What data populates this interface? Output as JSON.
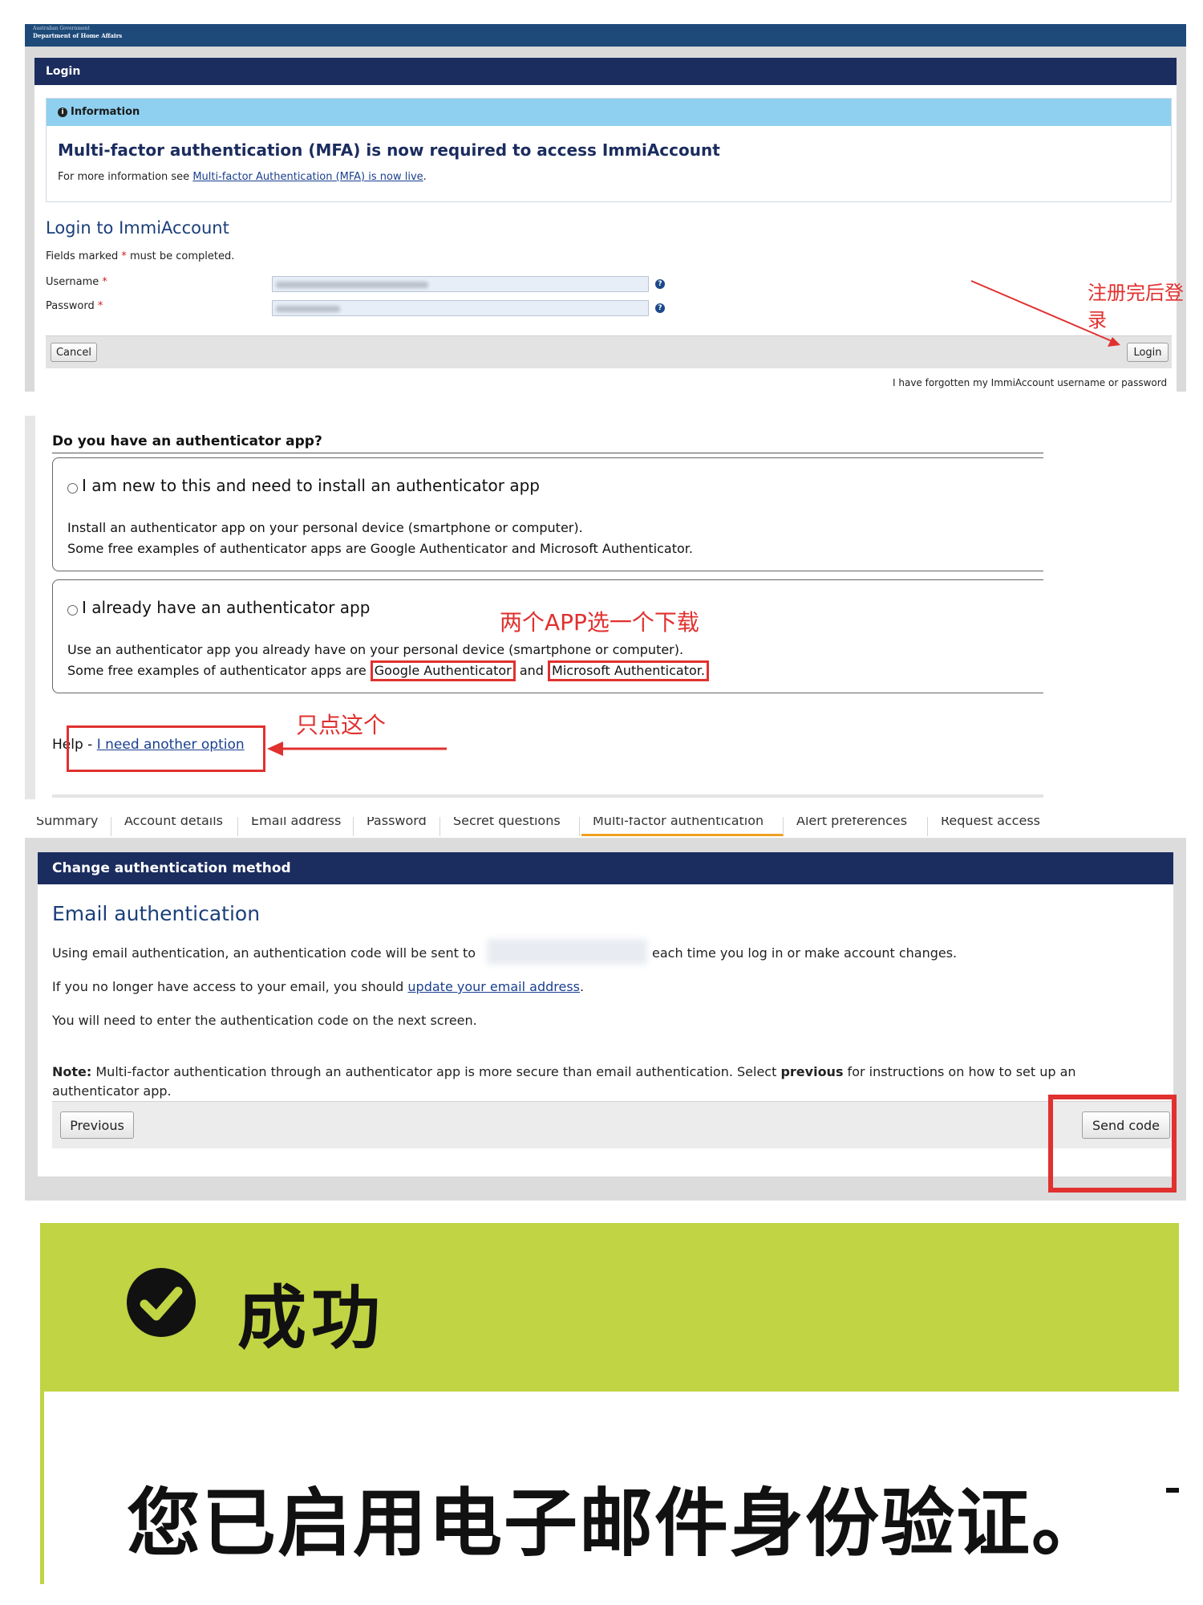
{
  "panel1": {
    "gov_line1": "Australian Government",
    "gov_line2": "Department of Home Affairs",
    "card_title": "Login",
    "info_label": "Information",
    "mfa_heading": "Multi-factor authentication (MFA) is now required to access ImmiAccount",
    "mfa_more_prefix": "For more information see ",
    "mfa_more_link": "Multi-factor Authentication (MFA) is now live",
    "mfa_more_suffix": ".",
    "login_title": "Login to ImmiAccount",
    "req_prefix": "Fields marked ",
    "req_star": "*",
    "req_suffix": " must be completed.",
    "username_label": "Username",
    "password_label": "Password",
    "required_star": "*",
    "help_glyph": "?",
    "cancel_label": "Cancel",
    "login_label": "Login",
    "forgot_link": "I have forgotten my ImmiAccount username or password",
    "annotation": "注册完后登录"
  },
  "panel2": {
    "question": "Do you have an authenticator app?",
    "opt1_title": "I am new to this and need to install an authenticator app",
    "opt1_line1": "Install an authenticator app on your personal device (smartphone or computer).",
    "opt1_line2": "Some free examples of authenticator apps are Google Authenticator and Microsoft Authenticator.",
    "opt2_title": "I already have an authenticator app",
    "opt2_line1": "Use an authenticator app you already have on your personal device (smartphone or computer).",
    "opt2_line2_prefix": "Some free examples of authenticator apps are ",
    "opt2_google": "Google Authenticator",
    "opt2_and": " and ",
    "opt2_microsoft": "Microsoft Authenticator.",
    "annotation_apps": "两个APP选一个下载",
    "help_prefix": "Help - ",
    "help_link": "I need another option",
    "annotation_click": "只点这个"
  },
  "panel3": {
    "tabs": [
      "Summary",
      "Account details",
      "Email address",
      "Password",
      "Secret questions",
      "Multi-factor authentication",
      "Alert preferences",
      "Request access"
    ],
    "card_title": "Change authentication method",
    "heading": "Email authentication",
    "line1_prefix": "Using email authentication, an authentication code will be sent to",
    "line1_suffix": "each time you log in or make account changes.",
    "line2_prefix": "If you no longer have access to your email, you should ",
    "line2_link": "update your email address",
    "line2_suffix": ".",
    "line3": "You will need to enter the authentication code on the next screen.",
    "note_label": "Note:",
    "note_text1": " Multi-factor authentication through an authenticator app is more secure than email authentication. Select ",
    "note_bold": "previous",
    "note_text2": " for instructions on how to set up an",
    "note_line2": "authenticator app.",
    "previous_label": "Previous",
    "send_code_label": "Send code"
  },
  "panel4": {
    "success_title": "成功",
    "success_message": "您已启用电子邮件身份验证。"
  },
  "colors": {
    "navy": "#1b2c5e",
    "info_blue": "#8fd0f0",
    "annotation_red": "#e0312f",
    "success_green": "#c0d444"
  }
}
